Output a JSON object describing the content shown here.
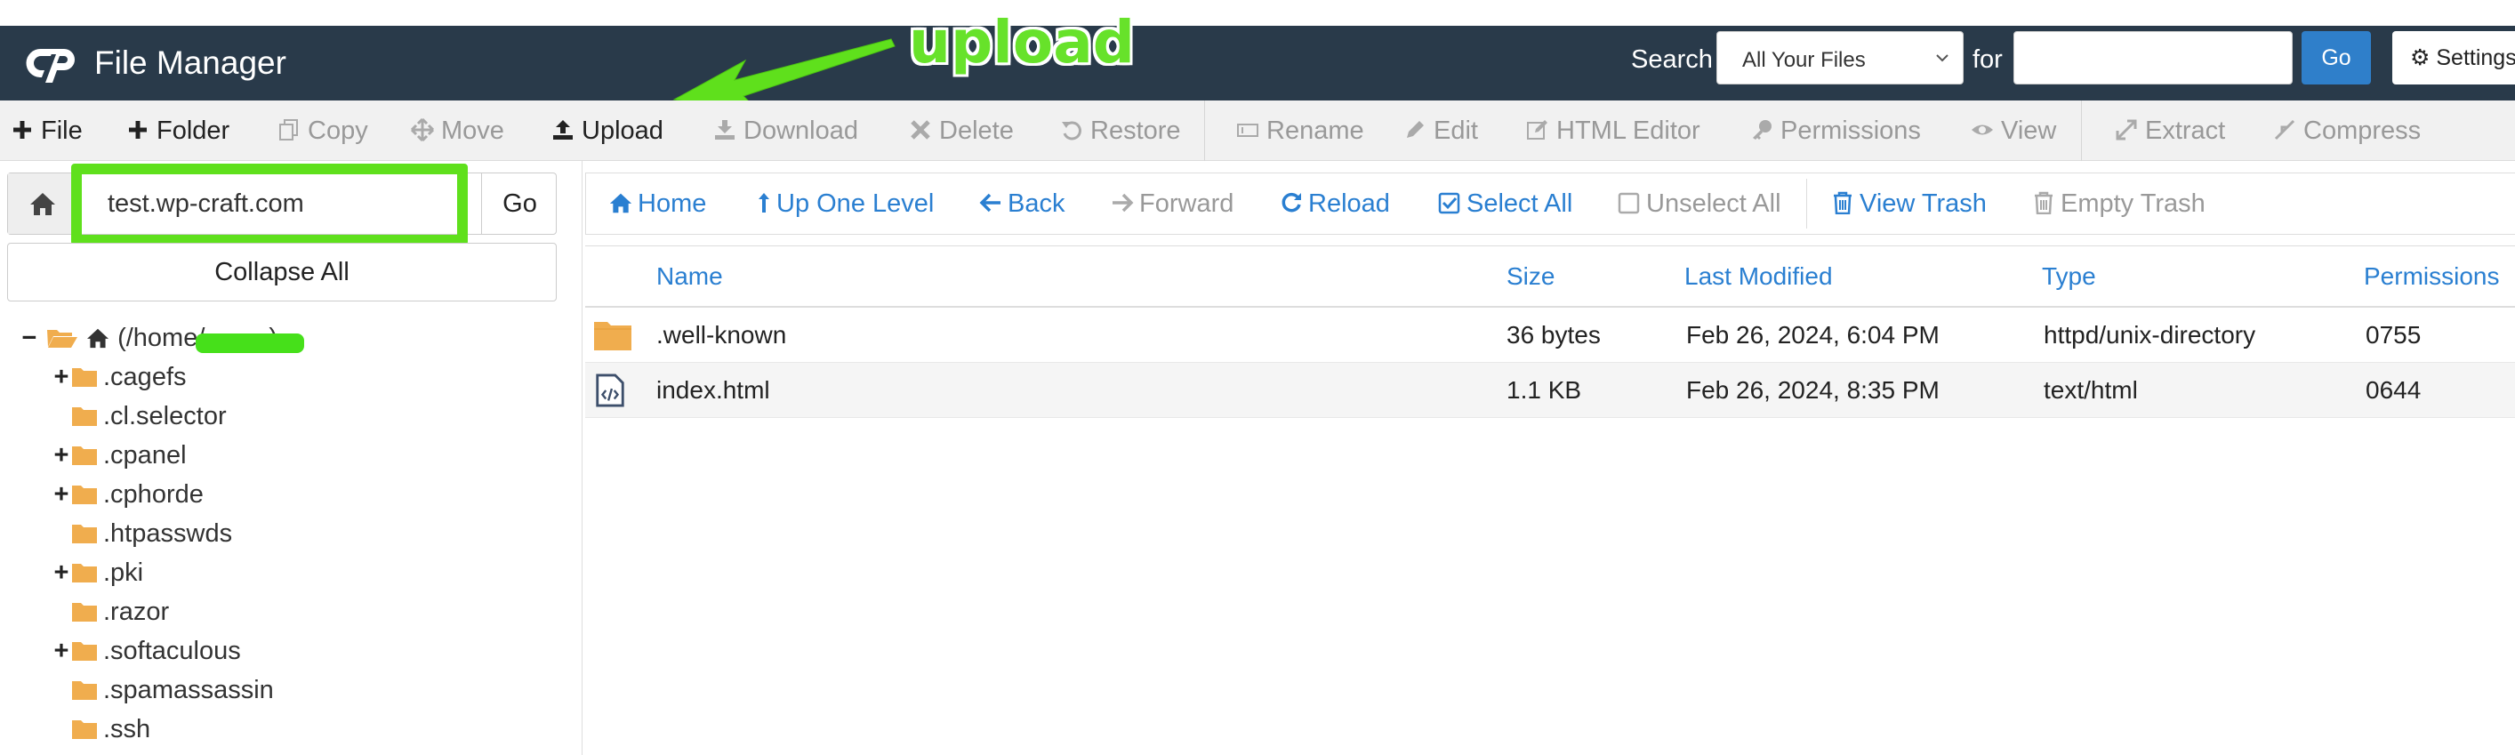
{
  "header": {
    "app_title": "File Manager",
    "search_label": "Search",
    "search_scope": "All Your Files",
    "for_label": "for",
    "search_value": "",
    "go_label": "Go",
    "settings_label": "Settings"
  },
  "annotation": {
    "text": "upload",
    "color": "#67e22a"
  },
  "toolbar": {
    "items": [
      {
        "label": "File",
        "icon": "plus-icon",
        "enabled": true
      },
      {
        "label": "Folder",
        "icon": "plus-icon",
        "enabled": true
      },
      {
        "label": "Copy",
        "icon": "copy-icon",
        "enabled": false
      },
      {
        "label": "Move",
        "icon": "move-icon",
        "enabled": false
      },
      {
        "label": "Upload",
        "icon": "upload-icon",
        "enabled": true
      },
      {
        "label": "Download",
        "icon": "download-icon",
        "enabled": false
      },
      {
        "label": "Delete",
        "icon": "close-icon",
        "enabled": false
      },
      {
        "label": "Restore",
        "icon": "restore-icon",
        "enabled": false
      },
      {
        "label": "Rename",
        "icon": "rename-icon",
        "enabled": false
      },
      {
        "label": "Edit",
        "icon": "pencil-icon",
        "enabled": false
      },
      {
        "label": "HTML Editor",
        "icon": "edit-box-icon",
        "enabled": false
      },
      {
        "label": "Permissions",
        "icon": "key-icon",
        "enabled": false
      },
      {
        "label": "View",
        "icon": "eye-icon",
        "enabled": false
      },
      {
        "label": "Extract",
        "icon": "expand-icon",
        "enabled": false
      },
      {
        "label": "Compress",
        "icon": "compress-icon",
        "enabled": false
      }
    ]
  },
  "left_panel": {
    "path_value": "test.wp-craft.com",
    "go_label": "Go",
    "collapse_label": "Collapse All",
    "tree": {
      "root_label_start": "(/home/",
      "root_label_end": ")",
      "items": [
        {
          "label": ".cagefs",
          "expandable": true
        },
        {
          "label": ".cl.selector",
          "expandable": false
        },
        {
          "label": ".cpanel",
          "expandable": true
        },
        {
          "label": ".cphorde",
          "expandable": true
        },
        {
          "label": ".htpasswds",
          "expandable": false
        },
        {
          "label": ".pki",
          "expandable": true
        },
        {
          "label": ".razor",
          "expandable": false
        },
        {
          "label": ".softaculous",
          "expandable": true
        },
        {
          "label": ".spamassassin",
          "expandable": false
        },
        {
          "label": ".ssh",
          "expandable": false
        }
      ]
    }
  },
  "nav": {
    "home": "Home",
    "up_one_level": "Up One Level",
    "back": "Back",
    "forward": "Forward",
    "reload": "Reload",
    "select_all": "Select All",
    "unselect_all": "Unselect All",
    "view_trash": "View Trash",
    "empty_trash": "Empty Trash"
  },
  "table": {
    "headers": {
      "name": "Name",
      "size": "Size",
      "modified": "Last Modified",
      "type": "Type",
      "permissions": "Permissions"
    },
    "rows": [
      {
        "icon": "folder-icon",
        "name": ".well-known",
        "size": "36 bytes",
        "modified": "Feb 26, 2024, 6:04 PM",
        "type": "httpd/unix-directory",
        "permissions": "0755"
      },
      {
        "icon": "html-file-icon",
        "name": "index.html",
        "size": "1.1 KB",
        "modified": "Feb 26, 2024, 8:35 PM",
        "type": "text/html",
        "permissions": "0644"
      }
    ]
  }
}
